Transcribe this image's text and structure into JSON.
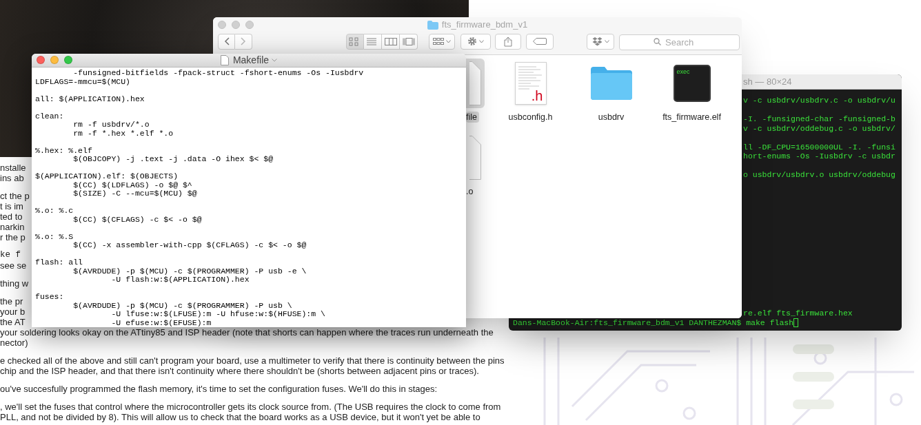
{
  "web_page": {
    "paragraphs": [
      {
        "lines": [
          {
            "kind": "text",
            "text": "nstalle"
          },
          {
            "kind": "text",
            "text": "ins ab"
          }
        ]
      },
      {
        "lines": [
          {
            "kind": "text",
            "text": "ct the p"
          },
          {
            "kind": "text",
            "text": "t is im"
          },
          {
            "kind": "text",
            "text": "ted to"
          },
          {
            "kind": "text",
            "text": "narkin"
          },
          {
            "kind": "text",
            "text": "r the p"
          }
        ]
      },
      {
        "lines": [
          {
            "kind": "code",
            "text": "ke f"
          },
          {
            "kind": "text",
            "text": "see se"
          }
        ]
      },
      {
        "lines": [
          {
            "kind": "text",
            "text": "thing w"
          }
        ]
      },
      {
        "lines": [
          {
            "kind": "text",
            "text": "the pr"
          },
          {
            "kind": "text",
            "text": "your b"
          },
          {
            "kind": "text",
            "text": "the AT"
          },
          {
            "kind": "text",
            "text": "your soldering looks okay on the ATtiny85 and ISP header (note that shorts can happen where the traces run underneath the"
          },
          {
            "kind": "text",
            "text": "nector)"
          }
        ]
      },
      {
        "lines": [
          {
            "kind": "text",
            "text": "e checked all of the above and still can't program your board, use a multimeter to verify that there is continuity between the pins"
          },
          {
            "kind": "text",
            "text": "chip and the ISP header, and that there isn't continuity where there shouldn't be (shorts between adjacent pins or traces)."
          }
        ]
      },
      {
        "lines": [
          {
            "kind": "text",
            "text": "ou've succesfully programmed the flash memory, it's time to set the configuration fuses. We'll do this in stages:"
          }
        ]
      },
      {
        "lines": [
          {
            "kind": "text",
            "text": ", we'll set the fuses that control where the microcontroller gets its clock source from. (The USB requires the clock to come from"
          },
          {
            "kind": "text",
            "text": "PLL, and not be divided by 8). This will allow us to check that the board works as a USB device, but it won't yet be able to"
          }
        ]
      }
    ]
  },
  "terminal": {
    "title": "sh — 80×24",
    "line_groups": [
      [
        "v -c usbdrv/usbdrv.c -o usbdrv/u"
      ],
      [
        "-I. -funsigned-char -funsigned-b",
        "v -c usbdrv/oddebug.c -o usbdrv/"
      ],
      [
        "ll -DF_CPU=16500000UL -I. -funsi",
        "hort-enums -Os -Iusbdrv -c usbdr"
      ],
      [
        "o usbdrv/usbdrv.o usbdrv/oddebug"
      ]
    ],
    "bottom_lines": [
      {
        "kind": "clipped",
        "text": "re.elf fts_firmware.hex"
      },
      {
        "kind": "full",
        "text": "Dans-MacBook-Air:fts_firmware_bdm_v1 DANTHEZMAN$ make flash"
      }
    ],
    "cursor": true
  },
  "finder": {
    "title": "fts_firmware_bdm_v1",
    "active": false,
    "view_modes": [
      {
        "kind": "icons",
        "selected": true
      },
      {
        "kind": "list",
        "selected": false
      },
      {
        "kind": "columns",
        "selected": false
      },
      {
        "kind": "gallery",
        "selected": false
      }
    ],
    "search": {
      "placeholder": "Search"
    },
    "items": [
      {
        "kind": "document",
        "label": "file",
        "selected": true
      },
      {
        "kind": "header",
        "label": "usbconfig.h",
        "badge": ".h",
        "selected": false
      },
      {
        "kind": "folder",
        "label": "usbdrv",
        "selected": false
      },
      {
        "kind": "executable",
        "label": "fts_firmware.elf",
        "badge": "exec",
        "selected": false
      },
      {
        "kind": "document",
        "label": ".o",
        "selected": false
      }
    ]
  },
  "editor": {
    "title": "Makefile",
    "active": true,
    "blocks": [
      [
        "\t-funsigned-bitfields -fpack-struct -fshort-enums -Os -Iusbdrv",
        "LDFLAGS=-mmcu=$(MCU)"
      ],
      [
        "all: $(APPLICATION).hex"
      ],
      [
        "clean:",
        "\trm -f usbdrv/*.o",
        "\trm -f *.hex *.elf *.o"
      ],
      [
        "%.hex: %.elf",
        "\t$(OBJCOPY) -j .text -j .data -O ihex $< $@"
      ],
      [
        "$(APPLICATION).elf: $(OBJECTS)",
        "\t$(CC) $(LDFLAGS) -o $@ $^",
        "\t$(SIZE) -C --mcu=$(MCU) $@"
      ],
      [
        "%.o: %.c",
        "\t$(CC) $(CFLAGS) -c $< -o $@"
      ],
      [
        "%.o: %.S",
        "\t$(CC) -x assembler-with-cpp $(CFLAGS) -c $< -o $@"
      ],
      [
        "flash: all",
        "\t$(AVRDUDE) -p $(MCU) -c $(PROGRAMMER) -P usb -e \\",
        "\t\t-U flash:w:$(APPLICATION).hex"
      ],
      [
        "fuses:",
        "\t$(AVRDUDE) -p $(MCU) -c $(PROGRAMMER) -P usb \\",
        "\t\t-U lfuse:w:$(LFUSE):m -U hfuse:w:$(HFUSE):m \\",
        "\t\t-U efuse:w:$(EFUSE):m"
      ]
    ]
  }
}
